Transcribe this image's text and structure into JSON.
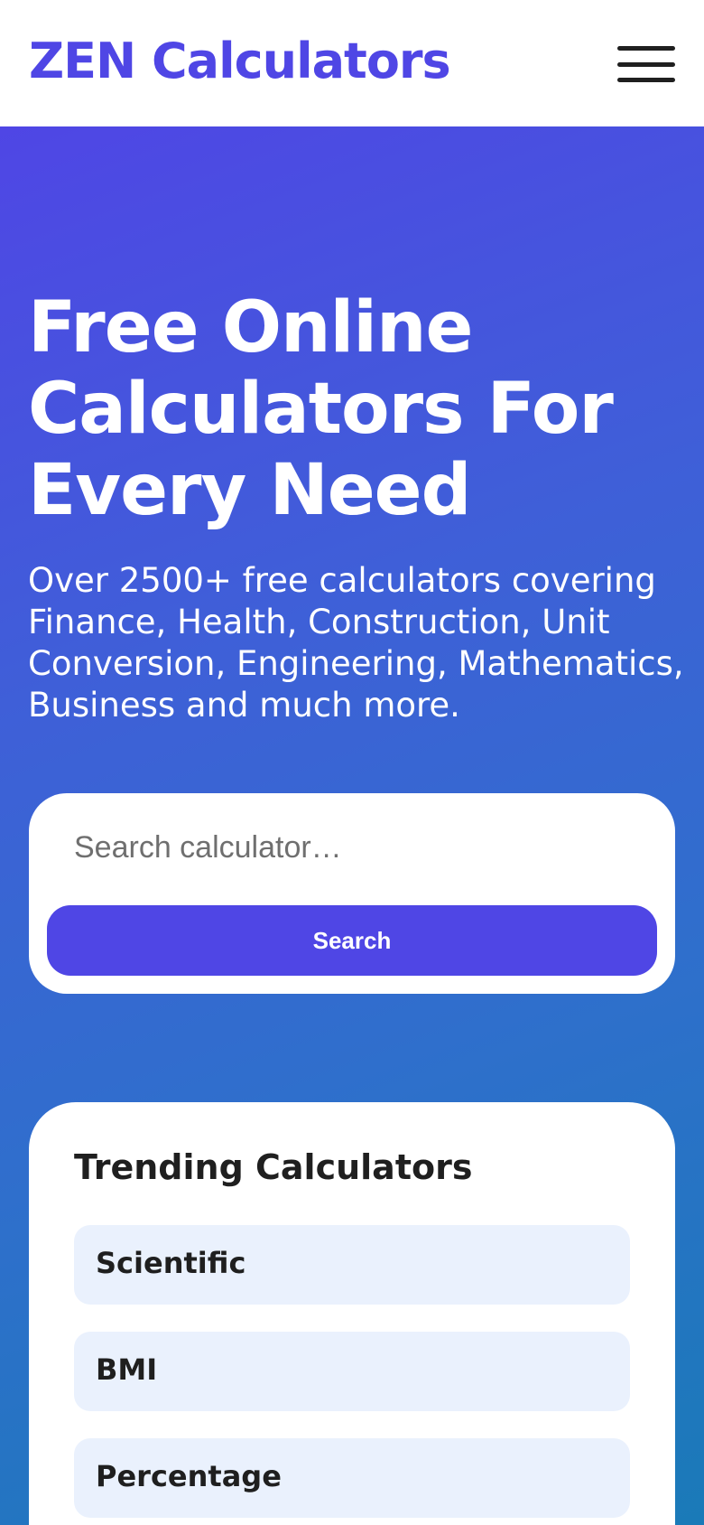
{
  "header": {
    "logo_text": "ZEN Calculators",
    "menu_icon": "hamburger-menu-icon"
  },
  "hero": {
    "title_lines": [
      "Free Online",
      "Calculators For",
      "Every Need"
    ],
    "subtitle": "Over 2500+ free calculators covering Finance, Health, Construction, Unit Conversion, Engineering, Mathematics, Business and much more."
  },
  "search": {
    "placeholder": "Search calculator…",
    "value": "",
    "button_label": "Search"
  },
  "trending": {
    "title": "Trending Calculators",
    "items": [
      {
        "label": "Scientific"
      },
      {
        "label": "BMI"
      },
      {
        "label": "Percentage"
      }
    ]
  },
  "colors": {
    "brand": "#4f46e5",
    "hero_gradient_start": "#4f46e5",
    "hero_gradient_end": "#1a7ab8",
    "trend_item_bg": "#eaf1fd"
  }
}
